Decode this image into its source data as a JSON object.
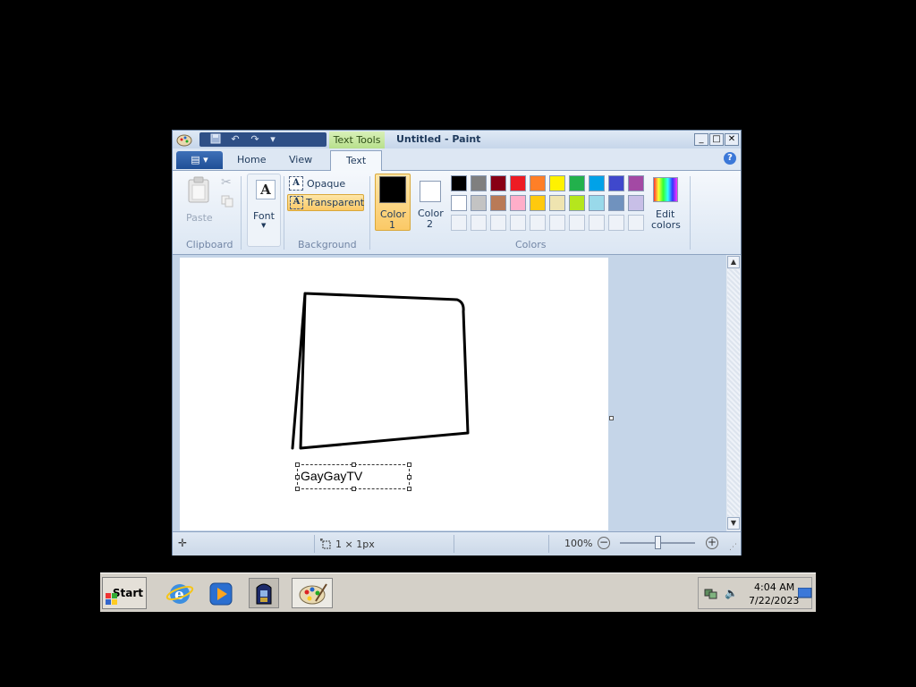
{
  "window": {
    "title": "Untitled - Paint",
    "contextual_tab": "Text Tools",
    "caption_buttons": [
      "_",
      "□",
      "✕"
    ]
  },
  "ribbon": {
    "tabs": [
      "Home",
      "View",
      "Text"
    ],
    "active_tab": "Text",
    "clipboard": {
      "paste": "Paste",
      "group": "Clipboard"
    },
    "font": {
      "label": "Font",
      "glyph": "A"
    },
    "background": {
      "opaque": "Opaque",
      "transparent": "Transparent",
      "group": "Background",
      "selected": "Transparent"
    },
    "colors": {
      "color1": "Color\n1",
      "color1_line1": "Color",
      "color1_line2": "1",
      "color2_line1": "Color",
      "color2_line2": "2",
      "edit_line1": "Edit",
      "edit_line2": "colors",
      "group": "Colors",
      "color1_value": "#000000",
      "color2_value": "#ffffff",
      "row1": [
        "#000000",
        "#7f7f7f",
        "#880015",
        "#ed1c24",
        "#ff7f27",
        "#fff200",
        "#22b14c",
        "#00a2e8",
        "#3f48cc",
        "#a349a4"
      ],
      "row2": [
        "#ffffff",
        "#c3c3c3",
        "#b97a57",
        "#ffaec9",
        "#ffc90e",
        "#efe4b0",
        "#b5e61d",
        "#99d9ea",
        "#7092be",
        "#c8bfe7"
      ]
    }
  },
  "canvas": {
    "text_box": "GayGayTV"
  },
  "status": {
    "size": "1 × 1px",
    "zoom": "100%"
  },
  "taskbar": {
    "start": "Start",
    "time": "4:04 AM",
    "date": "7/22/2023"
  }
}
